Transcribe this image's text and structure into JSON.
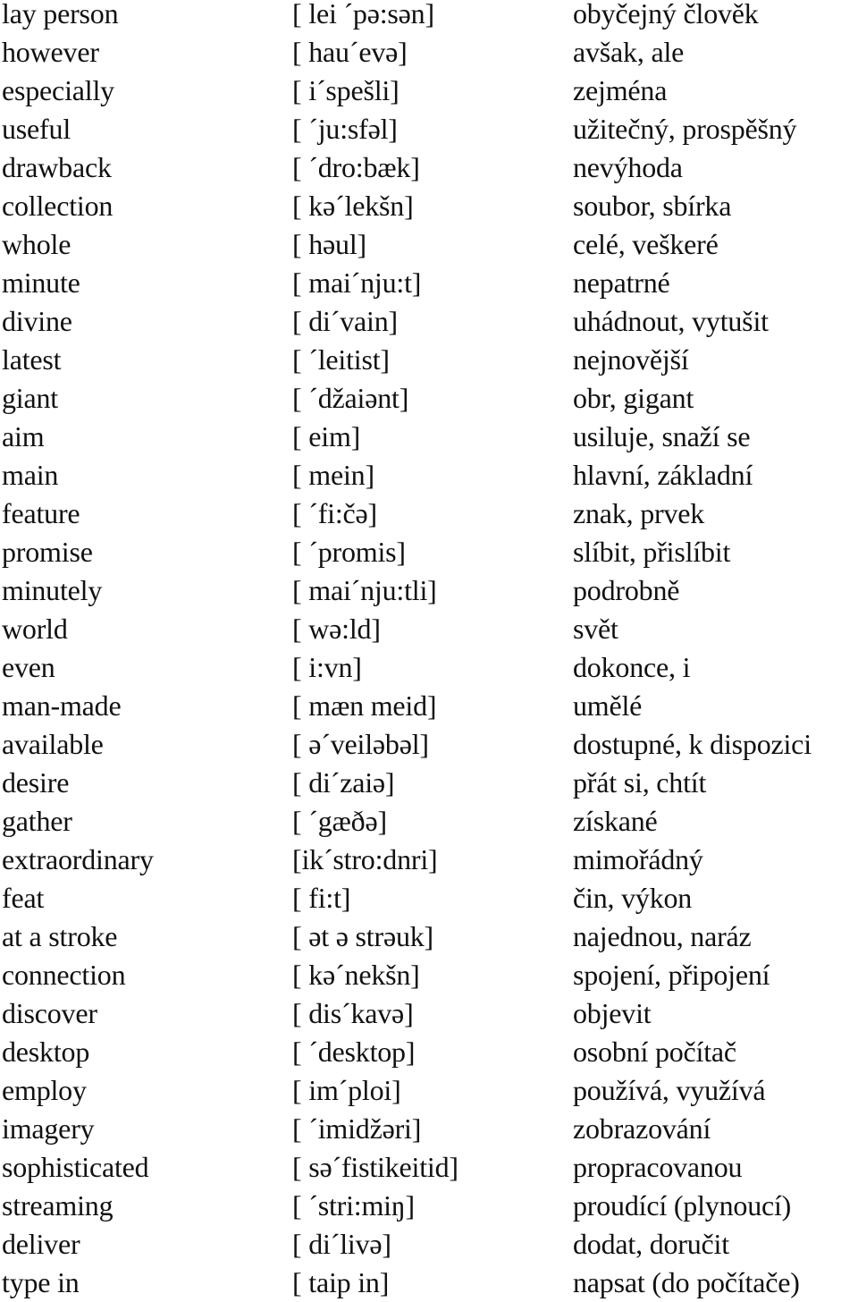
{
  "vocabulary": {
    "rows": [
      {
        "english": "lay person",
        "pronunciation": "[ lei ´pə:sən]",
        "czech": "obyčejný člověk"
      },
      {
        "english": "however",
        "pronunciation": "[ hau´evə]",
        "czech": "avšak, ale"
      },
      {
        "english": "especially",
        "pronunciation": "[ i´spešli]",
        "czech": "zejména"
      },
      {
        "english": "useful",
        "pronunciation": "[ ´ju:sfəl]",
        "czech": "užitečný, prospěšný"
      },
      {
        "english": "drawback",
        "pronunciation": "[ ´dro:bæk]",
        "czech": "nevýhoda"
      },
      {
        "english": "collection",
        "pronunciation": "[ kə´lekšn]",
        "czech": "soubor, sbírka"
      },
      {
        "english": "whole",
        "pronunciation": "[ həul]",
        "czech": "celé, veškeré"
      },
      {
        "english": "minute",
        "pronunciation": "[ mai´nju:t]",
        "czech": "nepatrné"
      },
      {
        "english": "divine",
        "pronunciation": "[ di´vain]",
        "czech": "uhádnout, vytušit"
      },
      {
        "english": "latest",
        "pronunciation": "[ ´leitist]",
        "czech": "nejnovější"
      },
      {
        "english": "giant",
        "pronunciation": "[ ´džaiənt]",
        "czech": "obr, gigant"
      },
      {
        "english": "aim",
        "pronunciation": "[ eim]",
        "czech": "usiluje, snaží se"
      },
      {
        "english": "main",
        "pronunciation": "[ mein]",
        "czech": "hlavní, základní"
      },
      {
        "english": "feature",
        "pronunciation": "[ ´fi:čə]",
        "czech": "znak, prvek"
      },
      {
        "english": "promise",
        "pronunciation": "[ ´promis]",
        "czech": "slíbit, přislíbit"
      },
      {
        "english": "minutely",
        "pronunciation": "[ mai´nju:tli]",
        "czech": "podrobně"
      },
      {
        "english": "world",
        "pronunciation": "[ wə:ld]",
        "czech": "svět"
      },
      {
        "english": "even",
        "pronunciation": "[ i:vn]",
        "czech": "dokonce, i"
      },
      {
        "english": "man-made",
        "pronunciation": "[ mæn meid]",
        "czech": "umělé"
      },
      {
        "english": "available",
        "pronunciation": "[ ə´veiləbəl]",
        "czech": "dostupné, k dispozici"
      },
      {
        "english": "desire",
        "pronunciation": "[ di´zaiə]",
        "czech": "přát si, chtít"
      },
      {
        "english": "gather",
        "pronunciation": "[ ´gæðə]",
        "czech": "získané"
      },
      {
        "english": "extraordinary",
        "pronunciation": "[ik´stro:dnri]",
        "czech": "mimořádný"
      },
      {
        "english": "feat",
        "pronunciation": "[ fi:t]",
        "czech": "čin, výkon"
      },
      {
        "english": "at a stroke",
        "pronunciation": "[ ət ə strəuk]",
        "czech": "najednou, naráz"
      },
      {
        "english": "connection",
        "pronunciation": "[ kə´nekšn]",
        "czech": "spojení, připojení"
      },
      {
        "english": "discover",
        "pronunciation": "[ dis´kavə]",
        "czech": "objevit"
      },
      {
        "english": "desktop",
        "pronunciation": "[ ´desktop]",
        "czech": "osobní počítač"
      },
      {
        "english": "employ",
        "pronunciation": "[ im´ploi]",
        "czech": "používá, využívá"
      },
      {
        "english": "imagery",
        "pronunciation": "[ ´imidžəri]",
        "czech": "zobrazování"
      },
      {
        "english": "sophisticated",
        "pronunciation": "[ sə´fistikeitid]",
        "czech": "propracovanou"
      },
      {
        "english": "streaming",
        "pronunciation": "[ ´stri:miŋ]",
        "czech": "proudící (plynoucí)"
      },
      {
        "english": "deliver",
        "pronunciation": "[ di´livə]",
        "czech": "dodat, doručit"
      },
      {
        "english": "type in",
        "pronunciation": "[ taip in]",
        "czech": "napsat (do počítače)"
      }
    ]
  }
}
